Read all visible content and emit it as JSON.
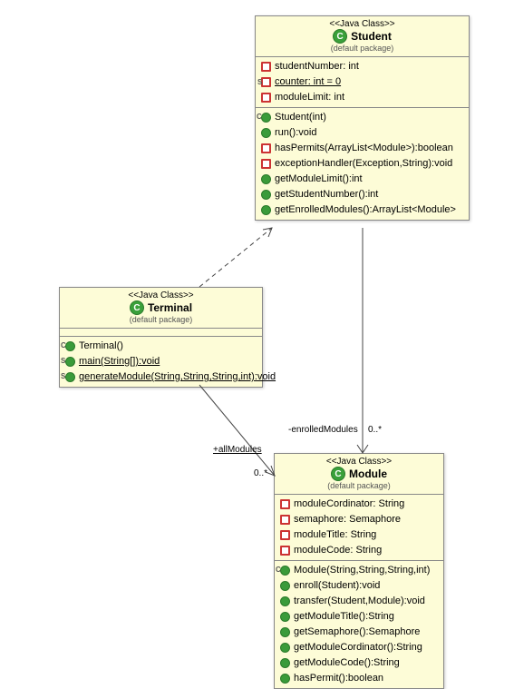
{
  "chart_data": {
    "type": "uml-class-diagram",
    "classes": [
      {
        "id": "student",
        "stereotype": "<<Java Class>>",
        "name": "Student",
        "package": "(default package)",
        "attributes": [
          {
            "vis": "private",
            "sig": "studentNumber: int",
            "static": false
          },
          {
            "vis": "private",
            "sig": "counter: int = 0",
            "static": true,
            "sup": "S"
          },
          {
            "vis": "private",
            "sig": "moduleLimit: int",
            "static": false
          }
        ],
        "operations": [
          {
            "vis": "constructor",
            "sig": "Student(int)",
            "sup": "C"
          },
          {
            "vis": "public",
            "sig": "run():void"
          },
          {
            "vis": "private",
            "sig": "hasPermits(ArrayList<Module>):boolean"
          },
          {
            "vis": "private",
            "sig": "exceptionHandler(Exception,String):void"
          },
          {
            "vis": "public",
            "sig": "getModuleLimit():int"
          },
          {
            "vis": "public",
            "sig": "getStudentNumber():int"
          },
          {
            "vis": "public",
            "sig": "getEnrolledModules():ArrayList<Module>"
          }
        ]
      },
      {
        "id": "terminal",
        "stereotype": "<<Java Class>>",
        "name": "Terminal",
        "package": "(default package)",
        "attributes": [],
        "operations": [
          {
            "vis": "constructor",
            "sig": "Terminal()",
            "sup": "C"
          },
          {
            "vis": "public",
            "sig": "main(String[]):void",
            "static": true,
            "sup": "S"
          },
          {
            "vis": "public",
            "sig": "generateModule(String,String,String,int):void",
            "static": true,
            "sup": "S"
          }
        ]
      },
      {
        "id": "module",
        "stereotype": "<<Java Class>>",
        "name": "Module",
        "package": "(default package)",
        "attributes": [
          {
            "vis": "private",
            "sig": "moduleCordinator: String"
          },
          {
            "vis": "private",
            "sig": "semaphore: Semaphore"
          },
          {
            "vis": "private",
            "sig": "moduleTitle: String"
          },
          {
            "vis": "private",
            "sig": "moduleCode: String"
          }
        ],
        "operations": [
          {
            "vis": "constructor",
            "sig": "Module(String,String,String,int)",
            "sup": "C"
          },
          {
            "vis": "public",
            "sig": "enroll(Student):void"
          },
          {
            "vis": "public",
            "sig": "transfer(Student,Module):void"
          },
          {
            "vis": "public",
            "sig": "getModuleTitle():String"
          },
          {
            "vis": "public",
            "sig": "getSemaphore():Semaphore"
          },
          {
            "vis": "public",
            "sig": "getModuleCordinator():String"
          },
          {
            "vis": "public",
            "sig": "getModuleCode():String"
          },
          {
            "vis": "public",
            "sig": "hasPermit():boolean"
          }
        ]
      }
    ],
    "relationships": [
      {
        "from": "terminal",
        "to": "student",
        "type": "dependency"
      },
      {
        "from": "student",
        "to": "module",
        "type": "association",
        "label": "-enrolledModules",
        "multiplicity": "0..*"
      },
      {
        "from": "terminal",
        "to": "module",
        "type": "association",
        "label": "+allModules",
        "multiplicity": "0..*",
        "static": true
      }
    ]
  },
  "labels": {
    "enrolled": "-enrolledModules",
    "enrolledMult": "0..*",
    "all": "+allModules",
    "allMult": "0..*"
  }
}
